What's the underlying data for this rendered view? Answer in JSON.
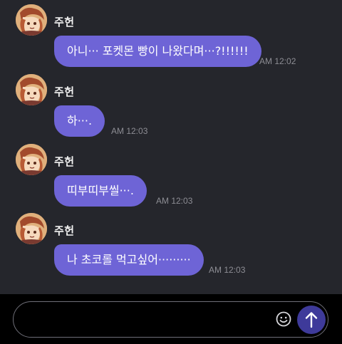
{
  "messages": [
    {
      "sender": "주헌",
      "text": "아니··· 포켓몬 빵이 나왔다며···?!!!!!!",
      "time": "AM 12:02"
    },
    {
      "sender": "주헌",
      "text": "하···.",
      "time": "AM 12:03"
    },
    {
      "sender": "주헌",
      "text": "띠부띠부씰···.",
      "time": "AM 12:03"
    },
    {
      "sender": "주헌",
      "text": "나 초코롤 먹고싶어·········",
      "time": "AM 12:03"
    }
  ],
  "input": {
    "value": "",
    "placeholder": ""
  },
  "icons": {
    "emoji": "smiley-face-icon",
    "send": "arrow-up-icon"
  },
  "colors": {
    "background": "#25262c",
    "bubble": "#6e64d6",
    "send_button": "#3e3a9a",
    "bottom_bar": "#000000"
  }
}
